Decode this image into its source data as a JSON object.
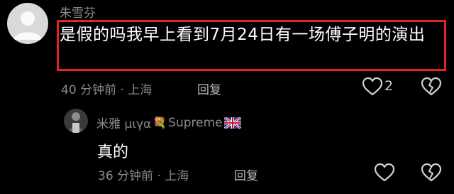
{
  "comment": {
    "username": "朱雪芬",
    "text": "是假的吗我早上看到7月24日有一场傅子明的演出",
    "meta": "40 分钟前 · 上海",
    "reply_label": "回复",
    "like_count": "2",
    "highlight_color": "#e8231f"
  },
  "reply": {
    "username_prefix": "米雅 μιγα",
    "flower_emoji": "💐",
    "username_suffix": "Supreme",
    "flag_icon": "uk-flag-icon",
    "text": "真的",
    "meta": "36 分钟前 · 上海",
    "reply_label": "回复"
  },
  "icons": {
    "like": "heart-icon",
    "dislike": "broken-heart-icon"
  }
}
